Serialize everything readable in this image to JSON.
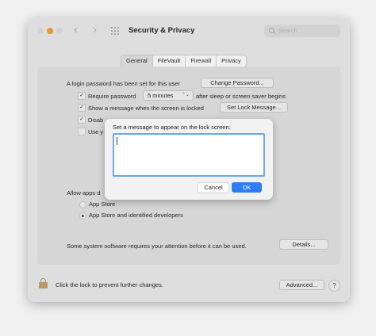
{
  "window": {
    "title": "Security & Privacy",
    "search_placeholder": "Search",
    "nav_back": "‹",
    "nav_forward": "›"
  },
  "tabs": [
    {
      "label": "General",
      "active": true
    },
    {
      "label": "FileVault",
      "active": false
    },
    {
      "label": "Firewall",
      "active": false
    },
    {
      "label": "Privacy",
      "active": false
    }
  ],
  "general": {
    "login_password_text": "A login password has been set for this user",
    "change_password_button": "Change Password...",
    "require_password_label": "Require password",
    "require_password_value": "5 minutes",
    "require_password_suffix": "after sleep or screen saver begins",
    "show_message_label": "Show a message when the screen is locked",
    "set_lock_message_button": "Set Lock Message...",
    "disable_label_partial": "Disab",
    "use_label_partial": "Use y",
    "allow_apps_partial": "Allow apps d",
    "radio_app_store": "App Store",
    "radio_app_store_identified": "App Store and identified developers",
    "system_software_text": "Some system software requires your attention before it can be used.",
    "details_button": "Details..."
  },
  "footer": {
    "lock_text": "Click the lock to prevent further changes.",
    "advanced_button": "Advanced...",
    "help_button": "?"
  },
  "dialog": {
    "prompt": "Set a message to appear on the lock screen:",
    "message_value": "",
    "cancel_button": "Cancel",
    "ok_button": "OK"
  },
  "colors": {
    "accent": "#2d7cf6",
    "focus_ring": "#6ea7e6"
  }
}
